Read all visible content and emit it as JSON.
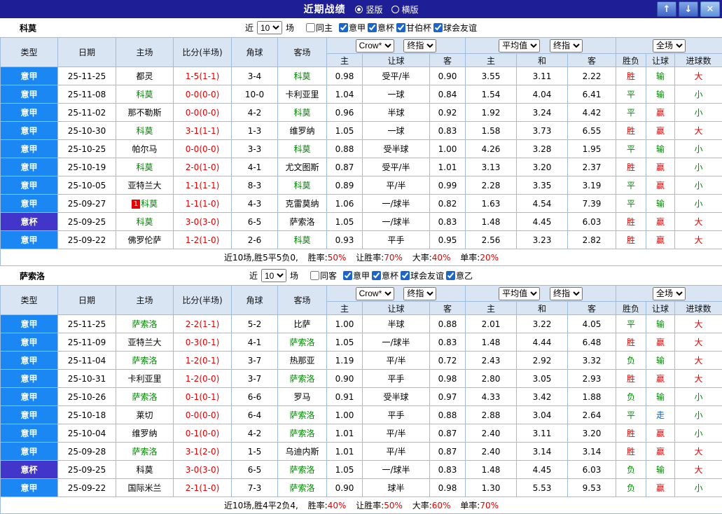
{
  "titlebar": {
    "title": "近期战绩",
    "layout_options": [
      {
        "label": "竖版",
        "selected": true
      },
      {
        "label": "横版",
        "selected": false
      }
    ],
    "up_icon": "↑",
    "down_icon": "↓",
    "close_icon": "✕"
  },
  "colors": {
    "titlebar_bg": "#1e1e96",
    "league_cell": "#1b87f2",
    "cup_cell": "#4136c9",
    "focus_team_green": "#008800",
    "score_red": "#e60000",
    "push_blue": "#0066cc",
    "header_bg": "#d9e5f3",
    "grid_border": "#9fbcdc"
  },
  "sections": [
    {
      "team": "科莫",
      "filter": {
        "near_label": "近",
        "count": "10",
        "games_label": "场",
        "same": {
          "label": "同主",
          "checked": false
        },
        "leagues": [
          {
            "label": "意甲",
            "checked": true
          },
          {
            "label": "意杯",
            "checked": true
          },
          {
            "label": "甘伯杯",
            "checked": true
          },
          {
            "label": "球会友谊",
            "checked": true
          }
        ]
      },
      "header": {
        "type": "类型",
        "date": "日期",
        "home": "主场",
        "score": "比分(半场)",
        "corner": "角球",
        "away": "客场",
        "bookmaker_select": "Crow*",
        "final_select_1": "终指",
        "average_select": "平均值",
        "final_select_2": "终指",
        "scope_select": "全场",
        "sub": [
          "主",
          "让球",
          "客",
          "主",
          "和",
          "客",
          "胜负",
          "让球",
          "进球数"
        ]
      },
      "rows": [
        {
          "league": "意甲",
          "cup": false,
          "date": "25-11-25",
          "home": "都灵",
          "hf": false,
          "badge": "",
          "score": "1-5(1-1)",
          "corner": "3-4",
          "away": "科莫",
          "af": true,
          "ah": [
            "0.98",
            "受平/半",
            "0.90"
          ],
          "eu": [
            "3.55",
            "3.11",
            "2.22"
          ],
          "res": [
            [
              "胜",
              "r"
            ],
            [
              "输",
              "g"
            ],
            [
              "大",
              "r"
            ]
          ]
        },
        {
          "league": "意甲",
          "cup": false,
          "date": "25-11-08",
          "home": "科莫",
          "hf": true,
          "badge": "",
          "score": "0-0(0-0)",
          "corner": "10-0",
          "away": "卡利亚里",
          "af": false,
          "ah": [
            "1.04",
            "一球",
            "0.84"
          ],
          "eu": [
            "1.54",
            "4.04",
            "6.41"
          ],
          "res": [
            [
              "平",
              "g"
            ],
            [
              "输",
              "g"
            ],
            [
              "小",
              "g"
            ]
          ]
        },
        {
          "league": "意甲",
          "cup": false,
          "date": "25-11-02",
          "home": "那不勒斯",
          "hf": false,
          "badge": "",
          "score": "0-0(0-0)",
          "corner": "4-2",
          "away": "科莫",
          "af": true,
          "ah": [
            "0.96",
            "半球",
            "0.92"
          ],
          "eu": [
            "1.92",
            "3.24",
            "4.42"
          ],
          "res": [
            [
              "平",
              "g"
            ],
            [
              "赢",
              "r"
            ],
            [
              "小",
              "g"
            ]
          ]
        },
        {
          "league": "意甲",
          "cup": false,
          "date": "25-10-30",
          "home": "科莫",
          "hf": true,
          "badge": "",
          "score": "3-1(1-1)",
          "corner": "1-3",
          "away": "维罗纳",
          "af": false,
          "ah": [
            "1.05",
            "一球",
            "0.83"
          ],
          "eu": [
            "1.58",
            "3.73",
            "6.55"
          ],
          "res": [
            [
              "胜",
              "r"
            ],
            [
              "赢",
              "r"
            ],
            [
              "大",
              "r"
            ]
          ]
        },
        {
          "league": "意甲",
          "cup": false,
          "date": "25-10-25",
          "home": "帕尔马",
          "hf": false,
          "badge": "",
          "score": "0-0(0-0)",
          "corner": "3-3",
          "away": "科莫",
          "af": true,
          "ah": [
            "0.88",
            "受半球",
            "1.00"
          ],
          "eu": [
            "4.26",
            "3.28",
            "1.95"
          ],
          "res": [
            [
              "平",
              "g"
            ],
            [
              "输",
              "g"
            ],
            [
              "小",
              "g"
            ]
          ]
        },
        {
          "league": "意甲",
          "cup": false,
          "date": "25-10-19",
          "home": "科莫",
          "hf": true,
          "badge": "",
          "score": "2-0(1-0)",
          "corner": "4-1",
          "away": "尤文图斯",
          "af": false,
          "ah": [
            "0.87",
            "受平/半",
            "1.01"
          ],
          "eu": [
            "3.13",
            "3.20",
            "2.37"
          ],
          "res": [
            [
              "胜",
              "r"
            ],
            [
              "赢",
              "r"
            ],
            [
              "小",
              "g"
            ]
          ]
        },
        {
          "league": "意甲",
          "cup": false,
          "date": "25-10-05",
          "home": "亚特兰大",
          "hf": false,
          "badge": "",
          "score": "1-1(1-1)",
          "corner": "8-3",
          "away": "科莫",
          "af": true,
          "ah": [
            "0.89",
            "平/半",
            "0.99"
          ],
          "eu": [
            "2.28",
            "3.35",
            "3.19"
          ],
          "res": [
            [
              "平",
              "g"
            ],
            [
              "赢",
              "r"
            ],
            [
              "小",
              "g"
            ]
          ]
        },
        {
          "league": "意甲",
          "cup": false,
          "date": "25-09-27",
          "home": "科莫",
          "hf": true,
          "badge": "1",
          "score": "1-1(1-0)",
          "corner": "4-3",
          "away": "克雷莫纳",
          "af": false,
          "ah": [
            "1.06",
            "一/球半",
            "0.82"
          ],
          "eu": [
            "1.63",
            "4.54",
            "7.39"
          ],
          "res": [
            [
              "平",
              "g"
            ],
            [
              "输",
              "g"
            ],
            [
              "小",
              "g"
            ]
          ]
        },
        {
          "league": "意杯",
          "cup": true,
          "date": "25-09-25",
          "home": "科莫",
          "hf": true,
          "badge": "",
          "score": "3-0(3-0)",
          "corner": "6-5",
          "away": "萨索洛",
          "af": false,
          "ah": [
            "1.05",
            "一/球半",
            "0.83"
          ],
          "eu": [
            "1.48",
            "4.45",
            "6.03"
          ],
          "res": [
            [
              "胜",
              "r"
            ],
            [
              "赢",
              "r"
            ],
            [
              "大",
              "r"
            ]
          ]
        },
        {
          "league": "意甲",
          "cup": false,
          "date": "25-09-22",
          "home": "佛罗伦萨",
          "hf": false,
          "badge": "",
          "score": "1-2(1-0)",
          "corner": "2-6",
          "away": "科莫",
          "af": true,
          "ah": [
            "0.93",
            "平手",
            "0.95"
          ],
          "eu": [
            "2.56",
            "3.23",
            "2.82"
          ],
          "res": [
            [
              "胜",
              "r"
            ],
            [
              "赢",
              "r"
            ],
            [
              "大",
              "r"
            ]
          ]
        }
      ],
      "summary": {
        "prefix": "近10场,胜5平5负0,",
        "stats": [
          {
            "label": "胜率:",
            "value": "50%"
          },
          {
            "label": "让胜率:",
            "value": "70%"
          },
          {
            "label": "大率:",
            "value": "40%"
          },
          {
            "label": "单率:",
            "value": "20%"
          }
        ]
      }
    },
    {
      "team": "萨索洛",
      "filter": {
        "near_label": "近",
        "count": "10",
        "games_label": "场",
        "same": {
          "label": "同客",
          "checked": false
        },
        "leagues": [
          {
            "label": "意甲",
            "checked": true
          },
          {
            "label": "意杯",
            "checked": true
          },
          {
            "label": "球会友谊",
            "checked": true
          },
          {
            "label": "意乙",
            "checked": true
          }
        ]
      },
      "header": {
        "type": "类型",
        "date": "日期",
        "home": "主场",
        "score": "比分(半场)",
        "corner": "角球",
        "away": "客场",
        "bookmaker_select": "Crow*",
        "final_select_1": "终指",
        "average_select": "平均值",
        "final_select_2": "终指",
        "scope_select": "全场",
        "sub": [
          "主",
          "让球",
          "客",
          "主",
          "和",
          "客",
          "胜负",
          "让球",
          "进球数"
        ]
      },
      "rows": [
        {
          "league": "意甲",
          "cup": false,
          "date": "25-11-25",
          "home": "萨索洛",
          "hf": true,
          "badge": "",
          "score": "2-2(1-1)",
          "corner": "5-2",
          "away": "比萨",
          "af": false,
          "ah": [
            "1.00",
            "半球",
            "0.88"
          ],
          "eu": [
            "2.01",
            "3.22",
            "4.05"
          ],
          "res": [
            [
              "平",
              "g"
            ],
            [
              "输",
              "g"
            ],
            [
              "大",
              "r"
            ]
          ]
        },
        {
          "league": "意甲",
          "cup": false,
          "date": "25-11-09",
          "home": "亚特兰大",
          "hf": false,
          "badge": "",
          "score": "0-3(0-1)",
          "corner": "4-1",
          "away": "萨索洛",
          "af": true,
          "ah": [
            "1.05",
            "一/球半",
            "0.83"
          ],
          "eu": [
            "1.48",
            "4.44",
            "6.48"
          ],
          "res": [
            [
              "胜",
              "r"
            ],
            [
              "赢",
              "r"
            ],
            [
              "大",
              "r"
            ]
          ]
        },
        {
          "league": "意甲",
          "cup": false,
          "date": "25-11-04",
          "home": "萨索洛",
          "hf": true,
          "badge": "",
          "score": "1-2(0-1)",
          "corner": "3-7",
          "away": "热那亚",
          "af": false,
          "ah": [
            "1.19",
            "平/半",
            "0.72"
          ],
          "eu": [
            "2.43",
            "2.92",
            "3.32"
          ],
          "res": [
            [
              "负",
              "g"
            ],
            [
              "输",
              "g"
            ],
            [
              "大",
              "r"
            ]
          ]
        },
        {
          "league": "意甲",
          "cup": false,
          "date": "25-10-31",
          "home": "卡利亚里",
          "hf": false,
          "badge": "",
          "score": "1-2(0-0)",
          "corner": "3-7",
          "away": "萨索洛",
          "af": true,
          "ah": [
            "0.90",
            "平手",
            "0.98"
          ],
          "eu": [
            "2.80",
            "3.05",
            "2.93"
          ],
          "res": [
            [
              "胜",
              "r"
            ],
            [
              "赢",
              "r"
            ],
            [
              "大",
              "r"
            ]
          ]
        },
        {
          "league": "意甲",
          "cup": false,
          "date": "25-10-26",
          "home": "萨索洛",
          "hf": true,
          "badge": "",
          "score": "0-1(0-1)",
          "corner": "6-6",
          "away": "罗马",
          "af": false,
          "ah": [
            "0.91",
            "受半球",
            "0.97"
          ],
          "eu": [
            "4.33",
            "3.42",
            "1.88"
          ],
          "res": [
            [
              "负",
              "g"
            ],
            [
              "输",
              "g"
            ],
            [
              "小",
              "g"
            ]
          ]
        },
        {
          "league": "意甲",
          "cup": false,
          "date": "25-10-18",
          "home": "莱切",
          "hf": false,
          "badge": "",
          "score": "0-0(0-0)",
          "corner": "6-4",
          "away": "萨索洛",
          "af": true,
          "ah": [
            "1.00",
            "平手",
            "0.88"
          ],
          "eu": [
            "2.88",
            "3.04",
            "2.64"
          ],
          "res": [
            [
              "平",
              "g"
            ],
            [
              "走",
              "b"
            ],
            [
              "小",
              "g"
            ]
          ]
        },
        {
          "league": "意甲",
          "cup": false,
          "date": "25-10-04",
          "home": "维罗纳",
          "hf": false,
          "badge": "",
          "score": "0-1(0-0)",
          "corner": "4-2",
          "away": "萨索洛",
          "af": true,
          "ah": [
            "1.01",
            "平/半",
            "0.87"
          ],
          "eu": [
            "2.40",
            "3.11",
            "3.20"
          ],
          "res": [
            [
              "胜",
              "r"
            ],
            [
              "赢",
              "r"
            ],
            [
              "小",
              "g"
            ]
          ]
        },
        {
          "league": "意甲",
          "cup": false,
          "date": "25-09-28",
          "home": "萨索洛",
          "hf": true,
          "badge": "",
          "score": "3-1(2-0)",
          "corner": "1-5",
          "away": "乌迪内斯",
          "af": false,
          "ah": [
            "1.01",
            "平/半",
            "0.87"
          ],
          "eu": [
            "2.40",
            "3.14",
            "3.14"
          ],
          "res": [
            [
              "胜",
              "r"
            ],
            [
              "赢",
              "r"
            ],
            [
              "大",
              "r"
            ]
          ]
        },
        {
          "league": "意杯",
          "cup": true,
          "date": "25-09-25",
          "home": "科莫",
          "hf": false,
          "badge": "",
          "score": "3-0(3-0)",
          "corner": "6-5",
          "away": "萨索洛",
          "af": true,
          "ah": [
            "1.05",
            "一/球半",
            "0.83"
          ],
          "eu": [
            "1.48",
            "4.45",
            "6.03"
          ],
          "res": [
            [
              "负",
              "g"
            ],
            [
              "输",
              "g"
            ],
            [
              "大",
              "r"
            ]
          ]
        },
        {
          "league": "意甲",
          "cup": false,
          "date": "25-09-22",
          "home": "国际米兰",
          "hf": false,
          "badge": "",
          "score": "2-1(1-0)",
          "corner": "7-3",
          "away": "萨索洛",
          "af": true,
          "ah": [
            "0.90",
            "球半",
            "0.98"
          ],
          "eu": [
            "1.30",
            "5.53",
            "9.53"
          ],
          "res": [
            [
              "负",
              "g"
            ],
            [
              "赢",
              "r"
            ],
            [
              "小",
              "g"
            ]
          ]
        }
      ],
      "summary": {
        "prefix": "近10场,胜4平2负4,",
        "stats": [
          {
            "label": "胜率:",
            "value": "40%"
          },
          {
            "label": "让胜率:",
            "value": "50%"
          },
          {
            "label": "大率:",
            "value": "60%"
          },
          {
            "label": "单率:",
            "value": "70%"
          }
        ]
      }
    }
  ]
}
